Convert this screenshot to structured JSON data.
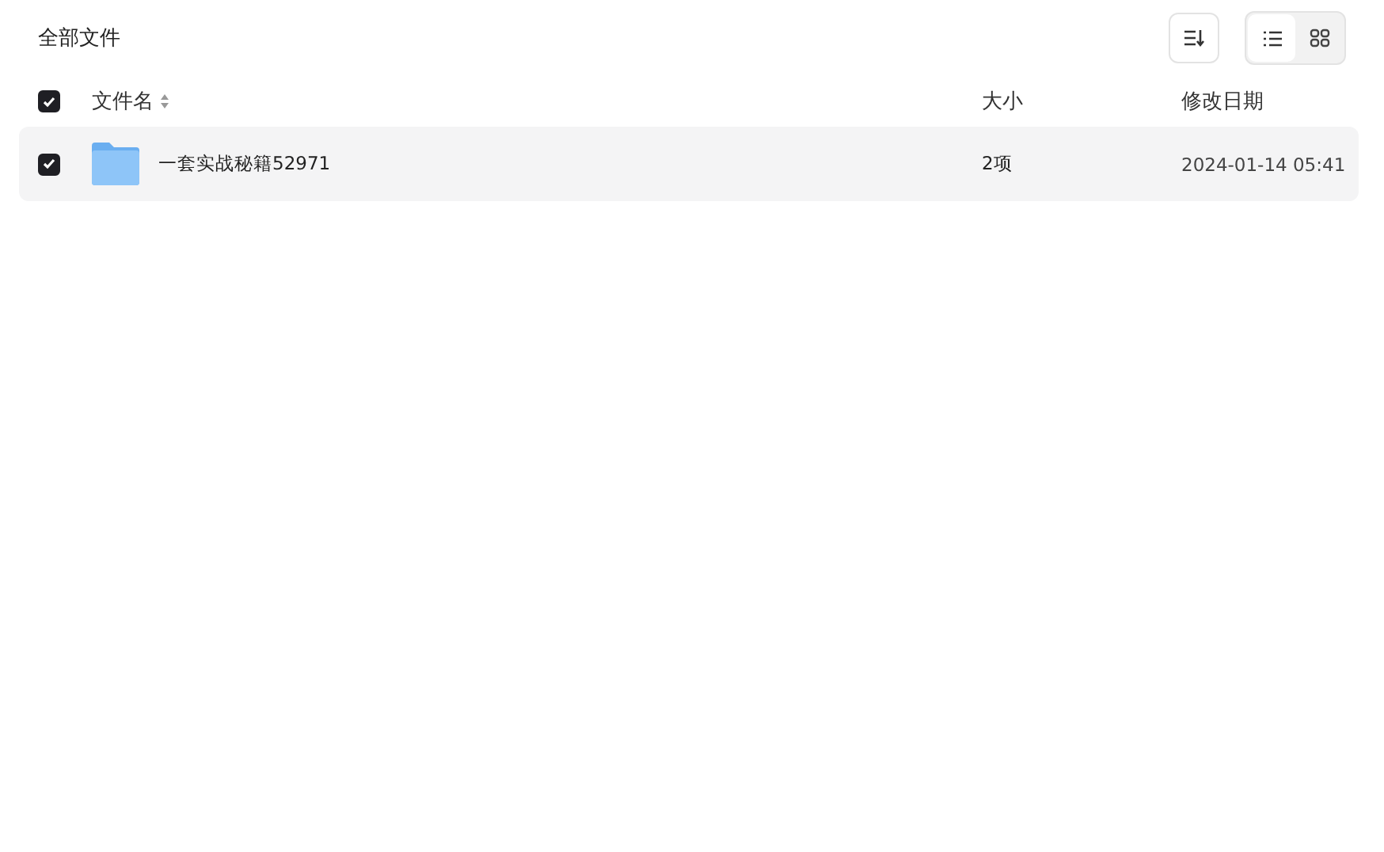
{
  "title": "全部文件",
  "toolbar": {
    "view_modes": [
      {
        "kind": "list",
        "selected": true
      },
      {
        "kind": "grid",
        "selected": false
      }
    ]
  },
  "table": {
    "select_all": {
      "checked": true
    },
    "columns": [
      {
        "label": "文件名",
        "sortable": true
      },
      {
        "label": "大小",
        "sortable": false
      },
      {
        "label": "修改日期",
        "sortable": false
      }
    ],
    "rows": [
      {
        "kind": "folder",
        "name": "一套实战秘籍52971",
        "size": "2项",
        "modified": "2024-01-14 05:41",
        "checked": true
      }
    ]
  }
}
